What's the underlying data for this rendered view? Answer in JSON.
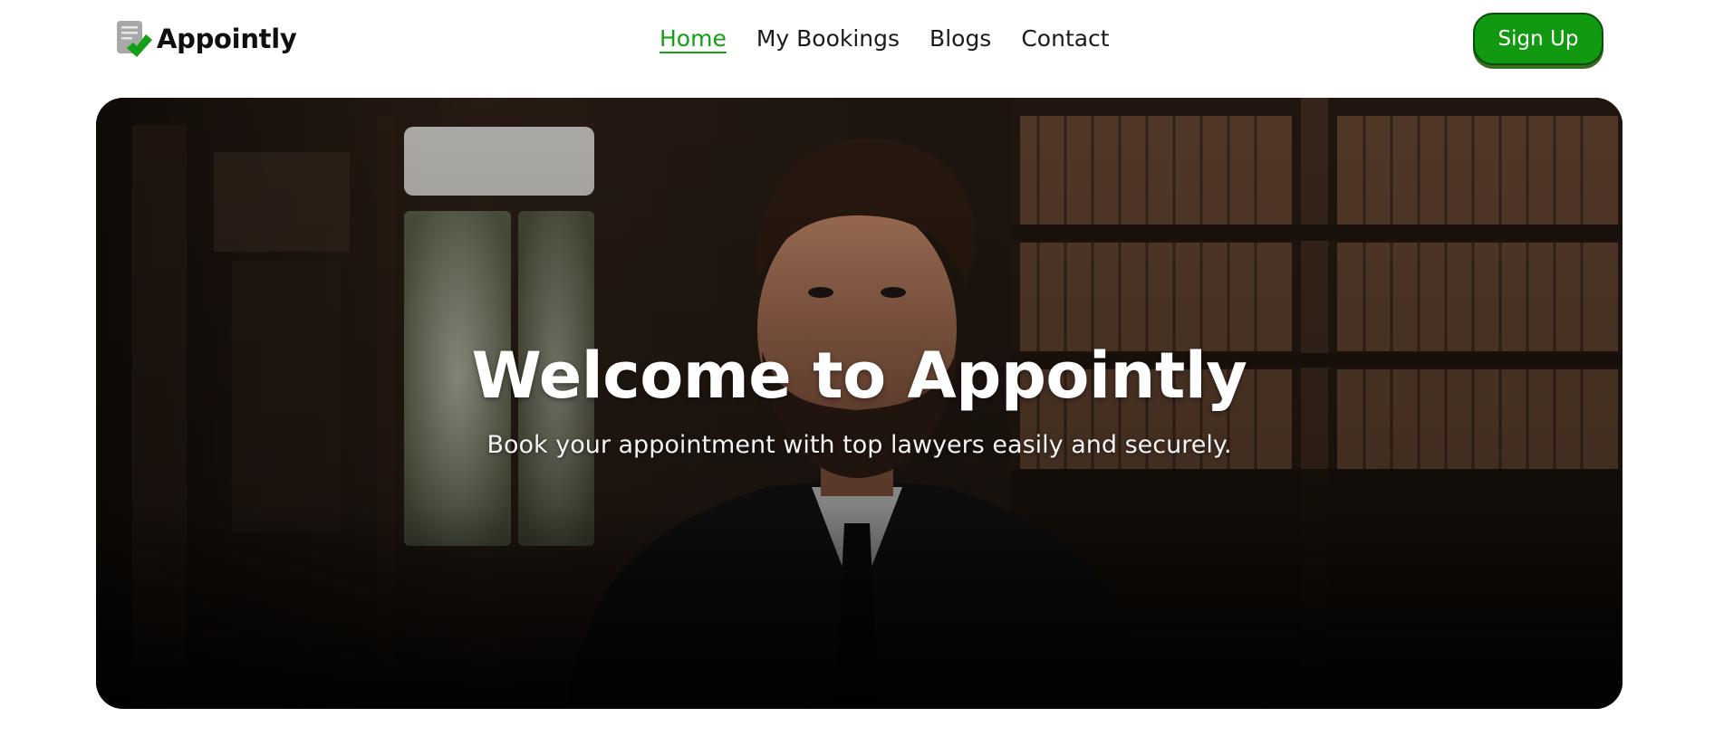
{
  "app": {
    "brand_name": "Appointly"
  },
  "nav": {
    "links": [
      {
        "label": "Home",
        "active": true
      },
      {
        "label": "My Bookings",
        "active": false
      },
      {
        "label": "Blogs",
        "active": false
      },
      {
        "label": "Contact",
        "active": false
      }
    ],
    "signup_label": "Sign Up"
  },
  "hero": {
    "title": "Welcome to Appointly",
    "subtitle": "Book your appointment with top lawyers easily and securely."
  },
  "colors": {
    "accent": "#14a014",
    "button_bg": "#119911",
    "text_dark": "#111111"
  },
  "icons": {
    "logo": "document-check-icon"
  }
}
